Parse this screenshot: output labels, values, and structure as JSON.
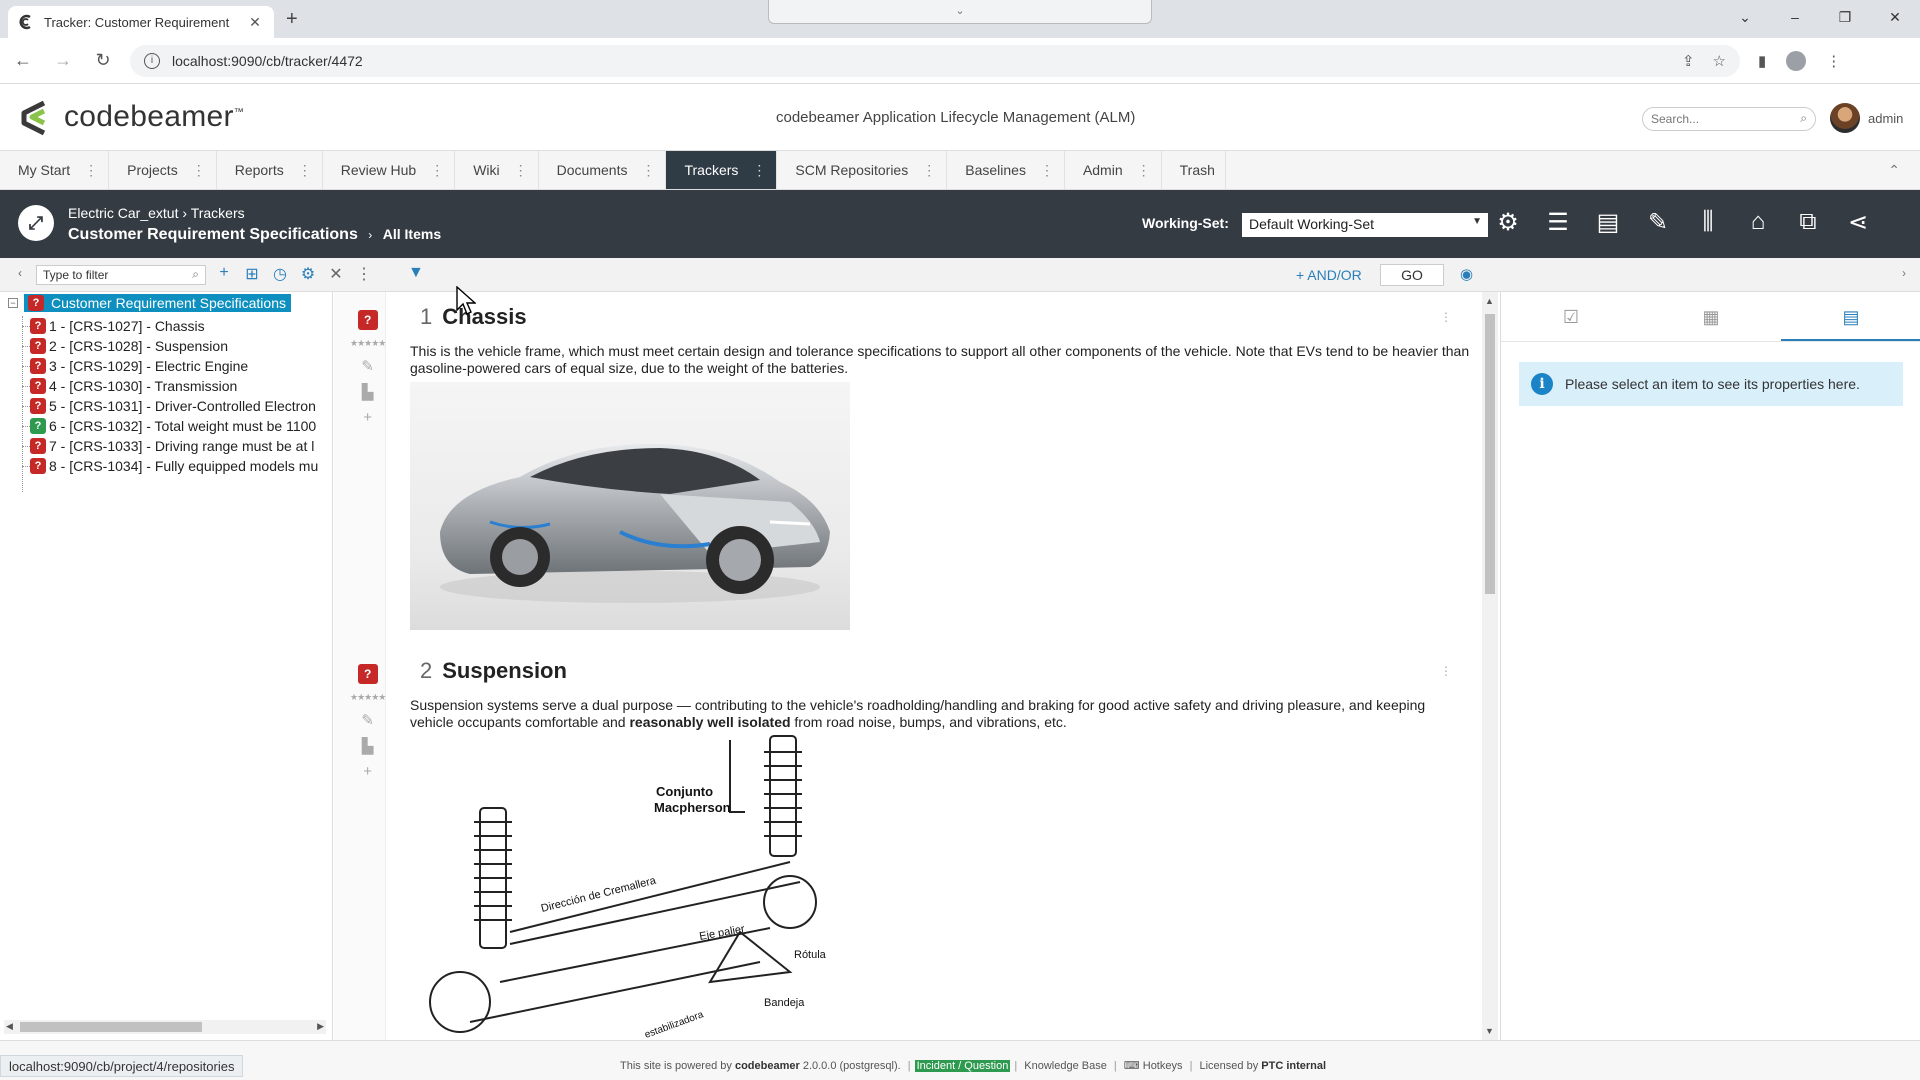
{
  "browser": {
    "tab_title": "Tracker: Customer Requirement",
    "tab_close": "✕",
    "new_tab": "+",
    "url": "localhost:9090/cb/tracker/4472",
    "dropdown_indicator": "⌄",
    "window_controls": [
      "⌄",
      "–",
      "❐",
      "✕"
    ]
  },
  "header": {
    "logo_text": "codebeamer",
    "logo_tm": "™",
    "app_title": "codebeamer Application Lifecycle Management (ALM)",
    "search_placeholder": "Search...",
    "user": "admin"
  },
  "nav": {
    "items": [
      {
        "label": "My Start",
        "active": false
      },
      {
        "label": "Projects",
        "active": false
      },
      {
        "label": "Reports",
        "active": false
      },
      {
        "label": "Review Hub",
        "active": false
      },
      {
        "label": "Wiki",
        "active": false
      },
      {
        "label": "Documents",
        "active": false
      },
      {
        "label": "Trackers",
        "active": true
      },
      {
        "label": "SCM Repositories",
        "active": false
      },
      {
        "label": "Baselines",
        "active": false
      },
      {
        "label": "Admin",
        "active": false
      },
      {
        "label": "Trash",
        "active": false
      }
    ],
    "menu_glyph": "⋮",
    "collapse_glyph": "⌃"
  },
  "tracker_bar": {
    "breadcrumb_project": "Electric Car_extut",
    "breadcrumb_sep": "›",
    "breadcrumb_section": "Trackers",
    "tracker_name": "Customer Requirement Specifications",
    "title_sep": "›",
    "view_name": "All Items",
    "working_set_label": "Working-Set:",
    "working_set_value": "Default Working-Set"
  },
  "toolbar": {
    "filter_placeholder": "Type to filter",
    "andor_label": "+ AND/OR",
    "go_label": "GO"
  },
  "tree": {
    "root_label": "Customer Requirement Specifications",
    "items": [
      {
        "label": "1 - [CRS-1027] - Chassis",
        "status": "red"
      },
      {
        "label": "2 - [CRS-1028] - Suspension",
        "status": "red"
      },
      {
        "label": "3 - [CRS-1029] - Electric Engine",
        "status": "red"
      },
      {
        "label": "4 - [CRS-1030] - Transmission",
        "status": "red"
      },
      {
        "label": "5 - [CRS-1031] - Driver-Controlled Electron",
        "status": "red"
      },
      {
        "label": "6 - [CRS-1032] - Total weight must be 1100",
        "status": "green"
      },
      {
        "label": "7 - [CRS-1033] - Driving range must be at l",
        "status": "red"
      },
      {
        "label": "8 - [CRS-1034] - Fully equipped models mu",
        "status": "red"
      }
    ]
  },
  "content": {
    "sections": [
      {
        "number": "1",
        "title": "Chassis",
        "text": "This is the vehicle frame, which must meet certain design and tolerance specifications to support all other components of the vehicle. Note that EVs tend to be heavier than gasoline-powered cars of equal size, due to the weight of the batteries."
      },
      {
        "number": "2",
        "title": "Suspension",
        "text_before": "Suspension systems serve a dual purpose — contributing to the vehicle's roadholding/handling and braking for good active safety and driving pleasure, and keeping vehicle occupants comfortable and ",
        "text_bold": "reasonably well isolated",
        "text_after": " from road noise, bumps, and vibrations, etc."
      }
    ],
    "diagram_labels": {
      "conjunto": "Conjunto",
      "macpherson": "Macpherson",
      "direccion": "Dirección de Cremallera",
      "eje": "Eje palier",
      "rotula": "Rótula",
      "bandeja": "Bandeja",
      "estabilizadora": "estabilizadora"
    },
    "stars": "★★★★★"
  },
  "properties_panel": {
    "info_message": "Please select an item to see its properties here."
  },
  "footer": {
    "status_url": "localhost:9090/cb/project/4/repositories",
    "powered_prefix": "This site is powered by",
    "powered_brand": "codebeamer",
    "version": "2.0.0.0 (postgresql).",
    "incident": "Incident / Question",
    "knowledge_base": "Knowledge Base",
    "hotkeys": "Hotkeys",
    "licensed_prefix": "Licensed by",
    "licensed_to": "PTC internal"
  }
}
